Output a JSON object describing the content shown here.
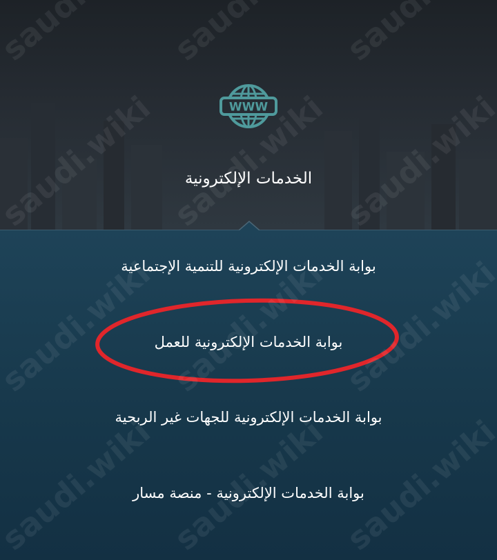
{
  "header": {
    "icon": "www-globe-icon",
    "icon_text": "WWW",
    "title": "الخدمات الإلكترونية"
  },
  "services": [
    {
      "label": "بوابة الخدمات الإلكترونية للتنمية الإجتماعية",
      "highlighted": false
    },
    {
      "label": "بوابة الخدمات الإلكترونية للعمل",
      "highlighted": true
    },
    {
      "label": "بوابة الخدمات الإلكترونية للجهات غير الربحية",
      "highlighted": false
    },
    {
      "label": "بوابة الخدمات الإلكترونية - منصة مسار",
      "highlighted": false
    }
  ],
  "watermark": "saudi.wiki",
  "colors": {
    "header_bg": "#262c33",
    "panel_bg": "#1a3d52",
    "icon": "#4f9a9c",
    "highlight_ring": "#e0262b",
    "text": "#ffffff"
  }
}
